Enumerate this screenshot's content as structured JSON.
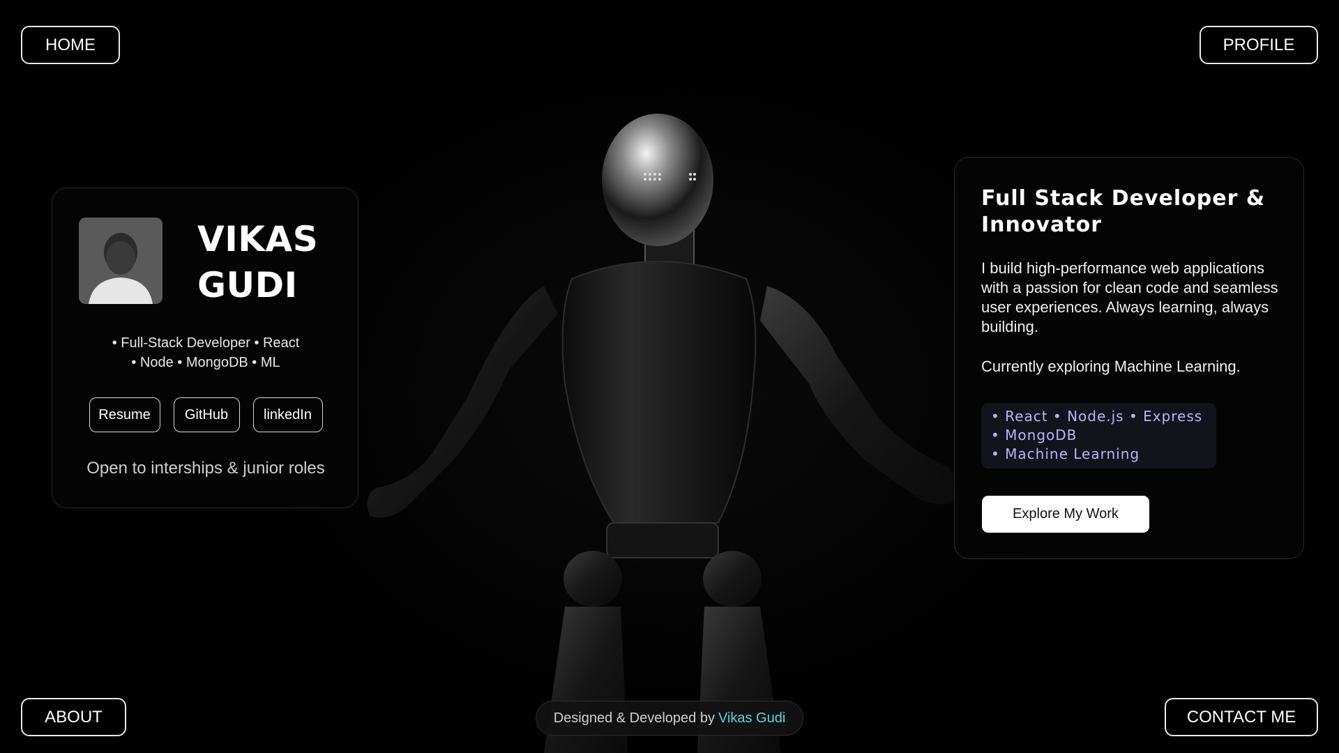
{
  "nav": {
    "home": "HOME",
    "profile": "PROFILE",
    "about": "ABOUT",
    "contact": "CONTACT ME"
  },
  "profile_card": {
    "name_line1": "VIKAS",
    "name_line2": "GUDI",
    "skills_line1": "• Full-Stack Developer • React",
    "skills_line2": "• Node • MongoDB • ML",
    "links": {
      "resume": "Resume",
      "github": "GitHub",
      "linkedin": "linkedIn"
    },
    "availability": "Open to interships & junior roles"
  },
  "about_card": {
    "title": "Full Stack Developer & Innovator",
    "bio": "I build high-performance web applications with a passion for clean code and seamless user experiences. Always learning, always building.",
    "exploring": "Currently exploring Machine Learning.",
    "tech_lines": [
      "• React • Node.js • Express",
      "• MongoDB",
      "• Machine Learning"
    ],
    "cta": "Explore My Work"
  },
  "footer": {
    "credit_prefix": "Designed & Developed by",
    "credit_name": "Vikas Gudi"
  },
  "colors": {
    "background": "#000000",
    "accent": "#5fd3d9",
    "tech_text": "#b9b4ff"
  }
}
